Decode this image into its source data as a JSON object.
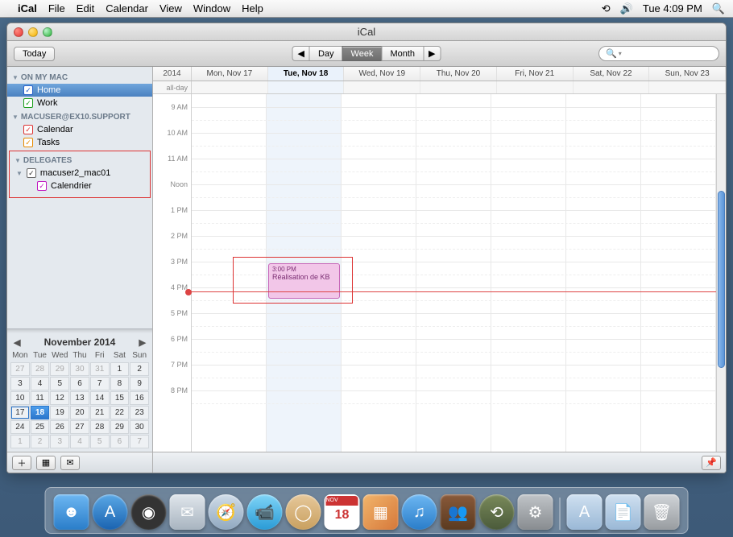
{
  "menubar": {
    "app": "iCal",
    "items": [
      "File",
      "Edit",
      "Calendar",
      "View",
      "Window",
      "Help"
    ],
    "clock": "Tue 4:09 PM"
  },
  "window": {
    "title": "iCal",
    "today_btn": "Today",
    "views": {
      "day": "Day",
      "week": "Week",
      "month": "Month"
    },
    "active_view": "Week",
    "search_placeholder": ""
  },
  "sidebar": {
    "groups": [
      {
        "name": "ON MY MAC",
        "items": [
          {
            "label": "Home",
            "color": "blue",
            "checked": true,
            "selected": true
          },
          {
            "label": "Work",
            "color": "green",
            "checked": true
          }
        ]
      },
      {
        "name": "MACUSER@EX10.SUPPORT",
        "items": [
          {
            "label": "Calendar",
            "color": "red",
            "checked": true
          },
          {
            "label": "Tasks",
            "color": "orange",
            "checked": true
          }
        ]
      },
      {
        "name": "DELEGATES",
        "highlight": true,
        "items": [
          {
            "label": "macuser2_mac01",
            "color": "gray",
            "checked": true,
            "hasDisclosure": true
          },
          {
            "label": "Calendrier",
            "color": "magenta",
            "checked": true,
            "indent": true
          }
        ]
      }
    ],
    "mini": {
      "title": "November 2014",
      "dows": [
        "Mon",
        "Tue",
        "Wed",
        "Thu",
        "Fri",
        "Sat",
        "Sun"
      ],
      "weeks": [
        [
          {
            "d": 27,
            "o": true
          },
          {
            "d": 28,
            "o": true
          },
          {
            "d": 29,
            "o": true
          },
          {
            "d": 30,
            "o": true
          },
          {
            "d": 31,
            "o": true
          },
          {
            "d": 1
          },
          {
            "d": 2
          }
        ],
        [
          {
            "d": 3
          },
          {
            "d": 4
          },
          {
            "d": 5
          },
          {
            "d": 6
          },
          {
            "d": 7
          },
          {
            "d": 8
          },
          {
            "d": 9
          }
        ],
        [
          {
            "d": 10
          },
          {
            "d": 11
          },
          {
            "d": 12
          },
          {
            "d": 13
          },
          {
            "d": 14
          },
          {
            "d": 15
          },
          {
            "d": 16
          }
        ],
        [
          {
            "d": 17,
            "today": true
          },
          {
            "d": 18,
            "sel": true
          },
          {
            "d": 19
          },
          {
            "d": 20
          },
          {
            "d": 21
          },
          {
            "d": 22
          },
          {
            "d": 23
          }
        ],
        [
          {
            "d": 24
          },
          {
            "d": 25
          },
          {
            "d": 26
          },
          {
            "d": 27
          },
          {
            "d": 28
          },
          {
            "d": 29
          },
          {
            "d": 30
          }
        ],
        [
          {
            "d": 1,
            "o": true
          },
          {
            "d": 2,
            "o": true
          },
          {
            "d": 3,
            "o": true
          },
          {
            "d": 4,
            "o": true
          },
          {
            "d": 5,
            "o": true
          },
          {
            "d": 6,
            "o": true
          },
          {
            "d": 7,
            "o": true
          }
        ]
      ]
    }
  },
  "calendar": {
    "year": "2014",
    "days": [
      {
        "label": "Mon, Nov 17"
      },
      {
        "label": "Tue, Nov 18",
        "today": true
      },
      {
        "label": "Wed, Nov 19"
      },
      {
        "label": "Thu, Nov 20"
      },
      {
        "label": "Fri, Nov 21"
      },
      {
        "label": "Sat, Nov 22"
      },
      {
        "label": "Sun, Nov 23"
      }
    ],
    "allday_label": "all-day",
    "hours": [
      "9 AM",
      "10 AM",
      "11 AM",
      "Noon",
      "1 PM",
      "2 PM",
      "3 PM",
      "4 PM",
      "5 PM",
      "6 PM",
      "7 PM",
      "8 PM"
    ],
    "hour_height": 32,
    "now_hour_index": 7.15,
    "event": {
      "time": "3:00 PM",
      "title": "Réalisation de KB",
      "day_index": 1,
      "start_index": 6,
      "span_hours": 1.5,
      "left_day": 0,
      "width_days": 1.6
    }
  },
  "dock": {
    "cal_day": "18"
  }
}
